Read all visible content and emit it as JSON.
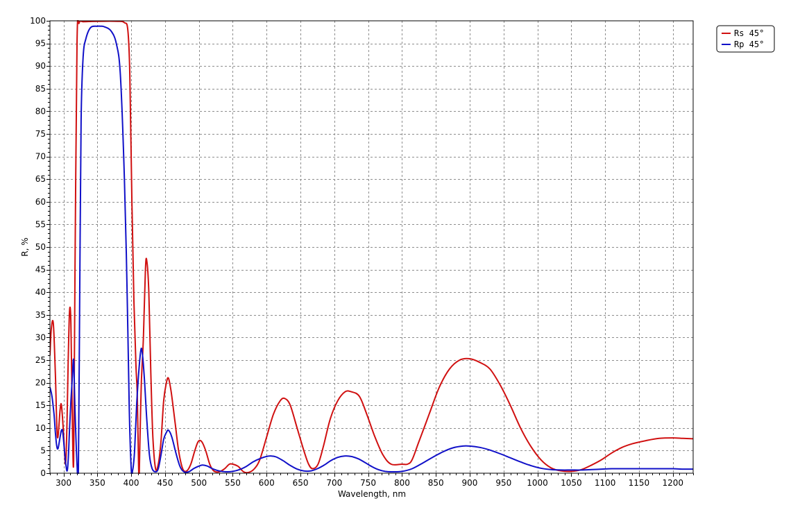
{
  "chart_data": {
    "type": "line",
    "xlabel": "Wavelength, nm",
    "ylabel": "R, %",
    "xlim": [
      280,
      1230
    ],
    "ylim": [
      0,
      100
    ],
    "x_ticks": [
      300,
      350,
      400,
      450,
      500,
      550,
      600,
      650,
      700,
      750,
      800,
      850,
      900,
      950,
      1000,
      1050,
      1100,
      1150,
      1200
    ],
    "y_ticks": [
      0,
      5,
      10,
      15,
      20,
      25,
      30,
      35,
      40,
      45,
      50,
      55,
      60,
      65,
      70,
      75,
      80,
      85,
      90,
      95,
      100
    ],
    "x_minor_step": 10,
    "y_minor_step": 1,
    "grid": true,
    "legend_position": "top-right",
    "series": [
      {
        "name": "Rs 45°",
        "color": "#d01010",
        "points": [
          [
            280,
            26
          ],
          [
            282,
            32
          ],
          [
            285,
            33
          ],
          [
            288,
            22
          ],
          [
            291,
            8
          ],
          [
            295,
            14
          ],
          [
            297,
            15
          ],
          [
            300,
            9
          ],
          [
            303,
            2
          ],
          [
            305,
            10
          ],
          [
            307,
            25
          ],
          [
            309,
            36
          ],
          [
            311,
            33
          ],
          [
            313,
            12
          ],
          [
            315,
            3
          ],
          [
            317,
            45
          ],
          [
            320,
            95
          ],
          [
            323,
            99.5
          ],
          [
            330,
            99.8
          ],
          [
            350,
            99.9
          ],
          [
            380,
            99.9
          ],
          [
            390,
            99.6
          ],
          [
            395,
            98
          ],
          [
            398,
            88
          ],
          [
            401,
            60
          ],
          [
            404,
            38
          ],
          [
            407,
            24
          ],
          [
            409,
            17
          ],
          [
            411,
            1
          ],
          [
            412,
            0.5
          ],
          [
            413,
            8
          ],
          [
            415,
            20
          ],
          [
            418,
            30
          ],
          [
            421,
            45
          ],
          [
            423,
            47
          ],
          [
            426,
            40
          ],
          [
            429,
            22
          ],
          [
            432,
            8
          ],
          [
            436,
            1
          ],
          [
            440,
            2
          ],
          [
            444,
            7
          ],
          [
            448,
            16
          ],
          [
            452,
            20
          ],
          [
            455,
            21
          ],
          [
            459,
            18
          ],
          [
            465,
            11
          ],
          [
            470,
            5
          ],
          [
            476,
            1
          ],
          [
            482,
            0.5
          ],
          [
            488,
            2
          ],
          [
            494,
            5
          ],
          [
            499,
            7
          ],
          [
            504,
            7
          ],
          [
            510,
            5
          ],
          [
            516,
            2
          ],
          [
            522,
            0.5
          ],
          [
            530,
            0.3
          ],
          [
            538,
            1
          ],
          [
            545,
            2
          ],
          [
            550,
            2
          ],
          [
            558,
            1.5
          ],
          [
            566,
            0.3
          ],
          [
            574,
            0.2
          ],
          [
            582,
            1
          ],
          [
            590,
            3
          ],
          [
            600,
            8
          ],
          [
            610,
            13
          ],
          [
            620,
            16
          ],
          [
            627,
            16.5
          ],
          [
            635,
            15
          ],
          [
            645,
            10
          ],
          [
            655,
            5
          ],
          [
            662,
            2
          ],
          [
            668,
            1
          ],
          [
            676,
            2
          ],
          [
            684,
            6
          ],
          [
            694,
            12
          ],
          [
            705,
            16
          ],
          [
            716,
            18
          ],
          [
            725,
            18
          ],
          [
            737,
            17
          ],
          [
            748,
            13
          ],
          [
            760,
            8
          ],
          [
            772,
            4
          ],
          [
            784,
            2
          ],
          [
            800,
            2
          ],
          [
            808,
            2
          ],
          [
            815,
            3
          ],
          [
            825,
            7
          ],
          [
            840,
            13
          ],
          [
            855,
            19
          ],
          [
            870,
            23
          ],
          [
            885,
            25
          ],
          [
            900,
            25.3
          ],
          [
            915,
            24.5
          ],
          [
            930,
            23
          ],
          [
            945,
            19.5
          ],
          [
            960,
            15
          ],
          [
            975,
            10
          ],
          [
            990,
            6
          ],
          [
            1005,
            3
          ],
          [
            1020,
            1.2
          ],
          [
            1035,
            0.5
          ],
          [
            1050,
            0.4
          ],
          [
            1065,
            0.8
          ],
          [
            1080,
            1.8
          ],
          [
            1095,
            3
          ],
          [
            1110,
            4.5
          ],
          [
            1125,
            5.7
          ],
          [
            1140,
            6.5
          ],
          [
            1160,
            7.2
          ],
          [
            1180,
            7.7
          ],
          [
            1200,
            7.8
          ],
          [
            1215,
            7.7
          ],
          [
            1230,
            7.6
          ]
        ]
      },
      {
        "name": "Rp 45°",
        "color": "#1010c8",
        "points": [
          [
            280,
            19
          ],
          [
            283,
            17
          ],
          [
            286,
            13
          ],
          [
            288,
            9
          ],
          [
            290,
            6
          ],
          [
            292,
            5.5
          ],
          [
            295,
            8
          ],
          [
            297,
            9.5
          ],
          [
            299,
            9
          ],
          [
            302,
            4
          ],
          [
            305,
            0.5
          ],
          [
            307,
            3
          ],
          [
            309,
            10
          ],
          [
            311,
            16
          ],
          [
            313,
            21
          ],
          [
            315,
            25
          ],
          [
            317,
            14
          ],
          [
            320,
            2
          ],
          [
            322,
            1
          ],
          [
            324,
            40
          ],
          [
            326,
            78
          ],
          [
            329,
            92
          ],
          [
            333,
            96
          ],
          [
            340,
            98.5
          ],
          [
            350,
            98.8
          ],
          [
            355,
            98.8
          ],
          [
            360,
            98.7
          ],
          [
            370,
            97.8
          ],
          [
            378,
            95
          ],
          [
            384,
            88
          ],
          [
            390,
            65
          ],
          [
            394,
            40
          ],
          [
            397,
            15
          ],
          [
            400,
            1
          ],
          [
            402,
            0.5
          ],
          [
            405,
            5
          ],
          [
            408,
            15
          ],
          [
            411,
            22
          ],
          [
            414,
            27
          ],
          [
            416,
            27
          ],
          [
            419,
            22
          ],
          [
            423,
            12
          ],
          [
            427,
            4
          ],
          [
            431,
            1
          ],
          [
            436,
            0.3
          ],
          [
            440,
            1
          ],
          [
            444,
            4
          ],
          [
            448,
            7.5
          ],
          [
            452,
            9
          ],
          [
            455,
            9.5
          ],
          [
            460,
            8
          ],
          [
            466,
            4.5
          ],
          [
            472,
            1.5
          ],
          [
            478,
            0.3
          ],
          [
            485,
            0.3
          ],
          [
            492,
            1
          ],
          [
            499,
            1.5
          ],
          [
            505,
            1.8
          ],
          [
            512,
            1.6
          ],
          [
            520,
            1
          ],
          [
            530,
            0.5
          ],
          [
            540,
            0.3
          ],
          [
            550,
            0.4
          ],
          [
            560,
            0.8
          ],
          [
            570,
            1.5
          ],
          [
            580,
            2.5
          ],
          [
            590,
            3.2
          ],
          [
            600,
            3.7
          ],
          [
            607,
            3.8
          ],
          [
            614,
            3.6
          ],
          [
            624,
            2.8
          ],
          [
            634,
            1.8
          ],
          [
            645,
            0.9
          ],
          [
            655,
            0.5
          ],
          [
            665,
            0.5
          ],
          [
            675,
            1
          ],
          [
            685,
            1.8
          ],
          [
            695,
            2.8
          ],
          [
            705,
            3.5
          ],
          [
            715,
            3.8
          ],
          [
            725,
            3.7
          ],
          [
            735,
            3.2
          ],
          [
            745,
            2.4
          ],
          [
            755,
            1.5
          ],
          [
            765,
            0.8
          ],
          [
            775,
            0.4
          ],
          [
            785,
            0.3
          ],
          [
            800,
            0.4
          ],
          [
            815,
            1
          ],
          [
            830,
            2.2
          ],
          [
            845,
            3.5
          ],
          [
            860,
            4.7
          ],
          [
            875,
            5.6
          ],
          [
            890,
            6
          ],
          [
            900,
            6
          ],
          [
            915,
            5.7
          ],
          [
            930,
            5.1
          ],
          [
            945,
            4.3
          ],
          [
            960,
            3.4
          ],
          [
            975,
            2.5
          ],
          [
            990,
            1.7
          ],
          [
            1005,
            1.1
          ],
          [
            1020,
            0.8
          ],
          [
            1035,
            0.7
          ],
          [
            1050,
            0.7
          ],
          [
            1065,
            0.7
          ],
          [
            1080,
            0.8
          ],
          [
            1095,
            0.9
          ],
          [
            1110,
            1
          ],
          [
            1130,
            1
          ],
          [
            1150,
            1
          ],
          [
            1180,
            1
          ],
          [
            1200,
            1
          ],
          [
            1215,
            0.9
          ],
          [
            1230,
            0.9
          ]
        ]
      }
    ]
  }
}
